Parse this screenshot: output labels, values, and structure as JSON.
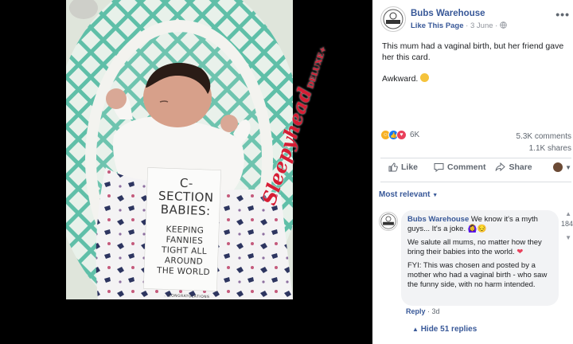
{
  "photo": {
    "card_title_1": "C-SECTION",
    "card_title_2": "BABIES:",
    "card_sub_1": "KEEPING FANNIES",
    "card_sub_2": "TIGHT ALL AROUND",
    "card_sub_3": "THE WORLD",
    "card_footer": "...CONGRATULATIONS",
    "brand_text": "Sleepyhead",
    "brand_suffix": "DELUXE+"
  },
  "post": {
    "page_name": "Bubs Warehouse",
    "like_page": "Like This Page",
    "date": "3 June",
    "text_1": "This mum had a vaginal birth, but her friend gave her this card.",
    "text_2": "Awkward.",
    "reaction_count": "6K",
    "comments_count": "5.3K comments",
    "shares_count": "1.1K shares",
    "actions": {
      "like": "Like",
      "comment": "Comment",
      "share": "Share"
    },
    "sort_label": "Most relevant"
  },
  "comment": {
    "author": "Bubs Warehouse",
    "line_1": "We know it's a myth guys... It's a joke.",
    "line_2": "We salute all mums, no matter how they bring their babies into the world.",
    "line_3": "FYI: This was chosen and posted by a mother who had a vaginal birth - who saw the funny side, with no harm intended.",
    "reply": "Reply",
    "age": "3d",
    "hide_replies": "Hide 51 replies",
    "side_count": "184"
  },
  "colors": {
    "link_blue": "#385898",
    "text_gray": "#606770",
    "bubble_bg": "#f2f3f5",
    "brand_red": "#d61d34"
  }
}
